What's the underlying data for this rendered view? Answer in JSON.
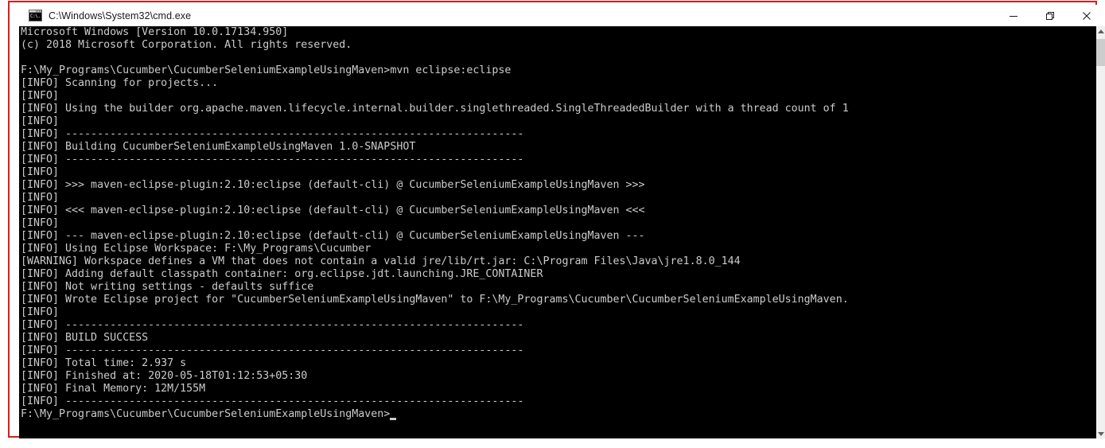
{
  "window": {
    "title": "C:\\Windows\\System32\\cmd.exe",
    "icon": "console-icon",
    "icon_glyph": "C:\\.",
    "border_color": "#e01b1b",
    "controls": [
      {
        "name": "minimize",
        "glyph": "minimize-icon"
      },
      {
        "name": "restore",
        "glyph": "restore-icon"
      },
      {
        "name": "close",
        "glyph": "close-icon"
      }
    ]
  },
  "console": {
    "background": "#000000",
    "foreground": "#cccccc",
    "lines": [
      "Microsoft Windows [Version 10.0.17134.950]",
      "(c) 2018 Microsoft Corporation. All rights reserved.",
      "",
      "F:\\My_Programs\\Cucumber\\CucumberSeleniumExampleUsingMaven>mvn eclipse:eclipse",
      "[INFO] Scanning for projects...",
      "[INFO]",
      "[INFO] Using the builder org.apache.maven.lifecycle.internal.builder.singlethreaded.SingleThreadedBuilder with a thread count of 1",
      "[INFO]",
      "[INFO] ------------------------------------------------------------------------",
      "[INFO] Building CucumberSeleniumExampleUsingMaven 1.0-SNAPSHOT",
      "[INFO] ------------------------------------------------------------------------",
      "[INFO]",
      "[INFO] >>> maven-eclipse-plugin:2.10:eclipse (default-cli) @ CucumberSeleniumExampleUsingMaven >>>",
      "[INFO]",
      "[INFO] <<< maven-eclipse-plugin:2.10:eclipse (default-cli) @ CucumberSeleniumExampleUsingMaven <<<",
      "[INFO]",
      "[INFO] --- maven-eclipse-plugin:2.10:eclipse (default-cli) @ CucumberSeleniumExampleUsingMaven ---",
      "[INFO] Using Eclipse Workspace: F:\\My_Programs\\Cucumber",
      "[WARNING] Workspace defines a VM that does not contain a valid jre/lib/rt.jar: C:\\Program Files\\Java\\jre1.8.0_144",
      "[INFO] Adding default classpath container: org.eclipse.jdt.launching.JRE_CONTAINER",
      "[INFO] Not writing settings - defaults suffice",
      "[INFO] Wrote Eclipse project for \"CucumberSeleniumExampleUsingMaven\" to F:\\My_Programs\\Cucumber\\CucumberSeleniumExampleUsingMaven.",
      "[INFO]",
      "[INFO] ------------------------------------------------------------------------",
      "[INFO] BUILD SUCCESS",
      "[INFO] ------------------------------------------------------------------------",
      "[INFO] Total time: 2.937 s",
      "[INFO] Finished at: 2020-05-18T01:12:53+05:30",
      "[INFO] Final Memory: 12M/155M",
      "[INFO] ------------------------------------------------------------------------"
    ],
    "prompt": "F:\\My_Programs\\Cucumber\\CucumberSeleniumExampleUsingMaven>"
  },
  "scrollbar": {
    "up_arrow": "scroll-up-icon",
    "down_arrow": "scroll-down-icon"
  }
}
